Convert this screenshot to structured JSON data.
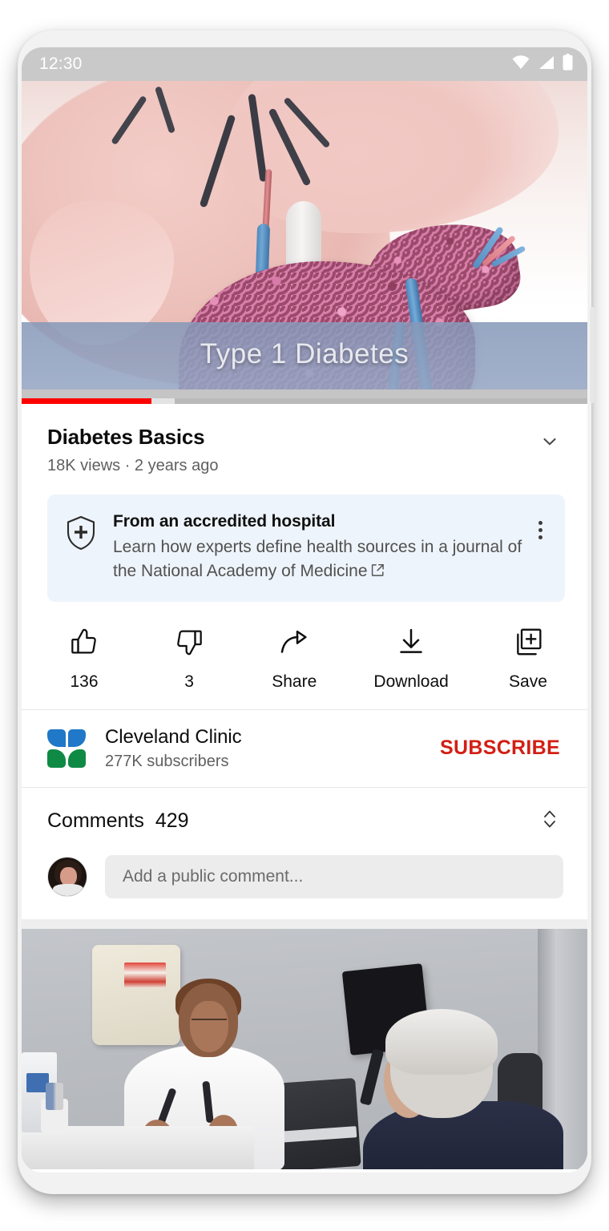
{
  "status_bar": {
    "time": "12:30",
    "icons": [
      "wifi-icon",
      "cell-signal-icon",
      "battery-icon"
    ]
  },
  "player": {
    "caption_overlay": "Type 1 Diabetes",
    "progress_percent": 23,
    "buffered_percent": 27,
    "progress_color": "#ff0000"
  },
  "video": {
    "title": "Diabetes Basics",
    "stats": "18K views · 2 years ago",
    "expand_icon": "chevron-down-icon"
  },
  "info_card": {
    "icon": "health-shield-icon",
    "title": "From an accredited hospital",
    "description": "Learn how experts define health sources in a journal of the National Academy of Medicine",
    "external_link_icon": "external-link-icon",
    "menu_icon": "more-vertical-icon",
    "background": "#eef4fb"
  },
  "actions": [
    {
      "name": "like",
      "icon": "thumbs-up-icon",
      "label": "136"
    },
    {
      "name": "dislike",
      "icon": "thumbs-down-icon",
      "label": "3"
    },
    {
      "name": "share",
      "icon": "share-arrow-icon",
      "label": "Share"
    },
    {
      "name": "download",
      "icon": "download-icon",
      "label": "Download"
    },
    {
      "name": "save",
      "icon": "save-plus-icon",
      "label": "Save"
    }
  ],
  "channel": {
    "logo": "cleveland-clinic-logo",
    "name": "Cleveland Clinic",
    "subscribers": "277K subscribers",
    "subscribe_label": "SUBSCRIBE",
    "subscribe_color": "#d21f14",
    "logo_colors": {
      "top": "#1f78c8",
      "bottom": "#0e8a45"
    }
  },
  "comments": {
    "label": "Comments",
    "count": "429",
    "sort_icon": "sort-chevrons-icon",
    "avatar": "user-avatar",
    "compose_placeholder": "Add a public comment..."
  },
  "next_video": {
    "thumbnail_alt": "doctor-consulting-patient-thumbnail"
  },
  "navigation": {
    "home_indicator": "gesture-home-pill"
  }
}
